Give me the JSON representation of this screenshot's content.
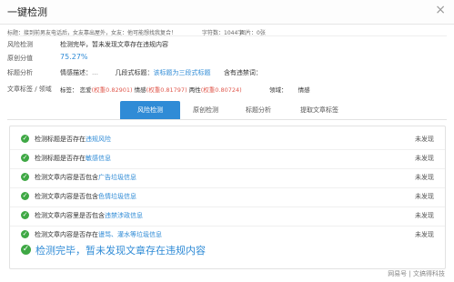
{
  "dialog": {
    "title": "一键检测",
    "close_symbol": "×"
  },
  "meta": {
    "title_label": "标题：接到前男友电话后，女友靠出屋外，女友：他可能想找我复合！",
    "word_count": "字符数：1044字",
    "image_count": "图片：0张"
  },
  "risk": {
    "label": "风险检测",
    "value": "检测完毕，暂未发现文章存在违规内容"
  },
  "originality": {
    "label": "原创分值",
    "value": "75.27%"
  },
  "title_analysis": {
    "label": "标题分析",
    "emotion_prefix": "情感描述：",
    "emotion_value": "…",
    "structure_prefix": "几段式标题：",
    "structure_value": "该标题为三段式标题",
    "ban_prefix": "含有违禁词："
  },
  "tags": {
    "label": "文章标签 / 领域",
    "tags_prefix": "标签：",
    "items": [
      {
        "name": "恋爱",
        "weight": "权重0.82901"
      },
      {
        "name": "情感",
        "weight": "权重0.81797"
      },
      {
        "name": "两性",
        "weight": "权重0.80724"
      }
    ],
    "domain_prefix": "领域：",
    "domain_value": "情感"
  },
  "tabs": [
    "风险检测",
    "原创检测",
    "标题分析",
    "提取文章标签"
  ],
  "checks": [
    {
      "pre": "检测标题是否存在",
      "hl": "违规风险",
      "status": "未发现"
    },
    {
      "pre": "检测标题是否存在",
      "hl": "敏感信息",
      "status": "未发现"
    },
    {
      "pre": "检测文章内容是否包含",
      "hl": "广告垃圾信息",
      "status": "未发现"
    },
    {
      "pre": "检测文章内容是否包含",
      "hl": "色情垃圾信息",
      "status": "未发现"
    },
    {
      "pre": "检测文章内容里是否包含",
      "hl": "违禁涉政信息",
      "status": "未发现"
    },
    {
      "pre": "检测文章内容是否存在",
      "hl": "谩骂、灌水等垃圾信息",
      "status": "未发现"
    }
  ],
  "final": "检测完毕，暂未发现文章存在违规内容",
  "watermark": "网易号 | 文搞得科技",
  "colors": {
    "accent": "#2f8bd6",
    "success": "#3fa845",
    "weight": "#e05a4f"
  }
}
